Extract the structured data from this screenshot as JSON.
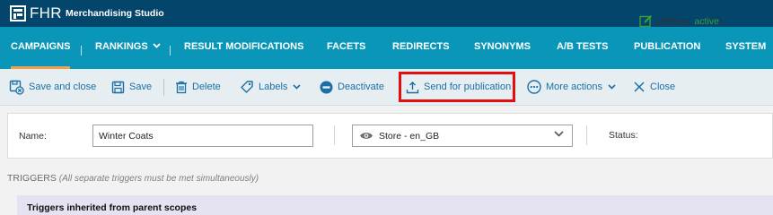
{
  "topbar": {
    "brand": "FHR",
    "app_name": "Merchandising Studio"
  },
  "nav": {
    "items": [
      {
        "label": "CAMPAIGNS",
        "active": true
      },
      {
        "label": "RANKINGS",
        "has_dropdown": true
      },
      {
        "label": "RESULT MODIFICATIONS"
      },
      {
        "label": "FACETS"
      },
      {
        "label": "REDIRECTS"
      },
      {
        "label": "SYNONYMS"
      },
      {
        "label": "A/B TESTS"
      },
      {
        "label": "PUBLICATION"
      },
      {
        "label": "SYSTEM"
      }
    ],
    "active_color": "#f0a050"
  },
  "toolbar": {
    "save_and_close": "Save and close",
    "save": "Save",
    "delete": "Delete",
    "labels": "Labels",
    "deactivate": "Deactivate",
    "send_for_publication": "Send for publication",
    "more_actions": "More actions",
    "close": "Close"
  },
  "form": {
    "name_label": "Name:",
    "name_value": "Winter Coats",
    "store_value": "Store - en_GB",
    "status_label": "Status:",
    "status_prefix": "(Editing, ",
    "status_state": "active",
    "status_suffix": ")"
  },
  "triggers": {
    "title": "TRIGGERS",
    "note": "(All separate triggers must be met simultaneously)",
    "inherited_title": "Triggers inherited from parent scopes"
  },
  "colors": {
    "topbar": "#04466b",
    "navbar": "#0a96b8",
    "toolbar_text": "#1b6fa5",
    "highlight": "#e30e0e",
    "status_active": "#3a9c3a"
  }
}
